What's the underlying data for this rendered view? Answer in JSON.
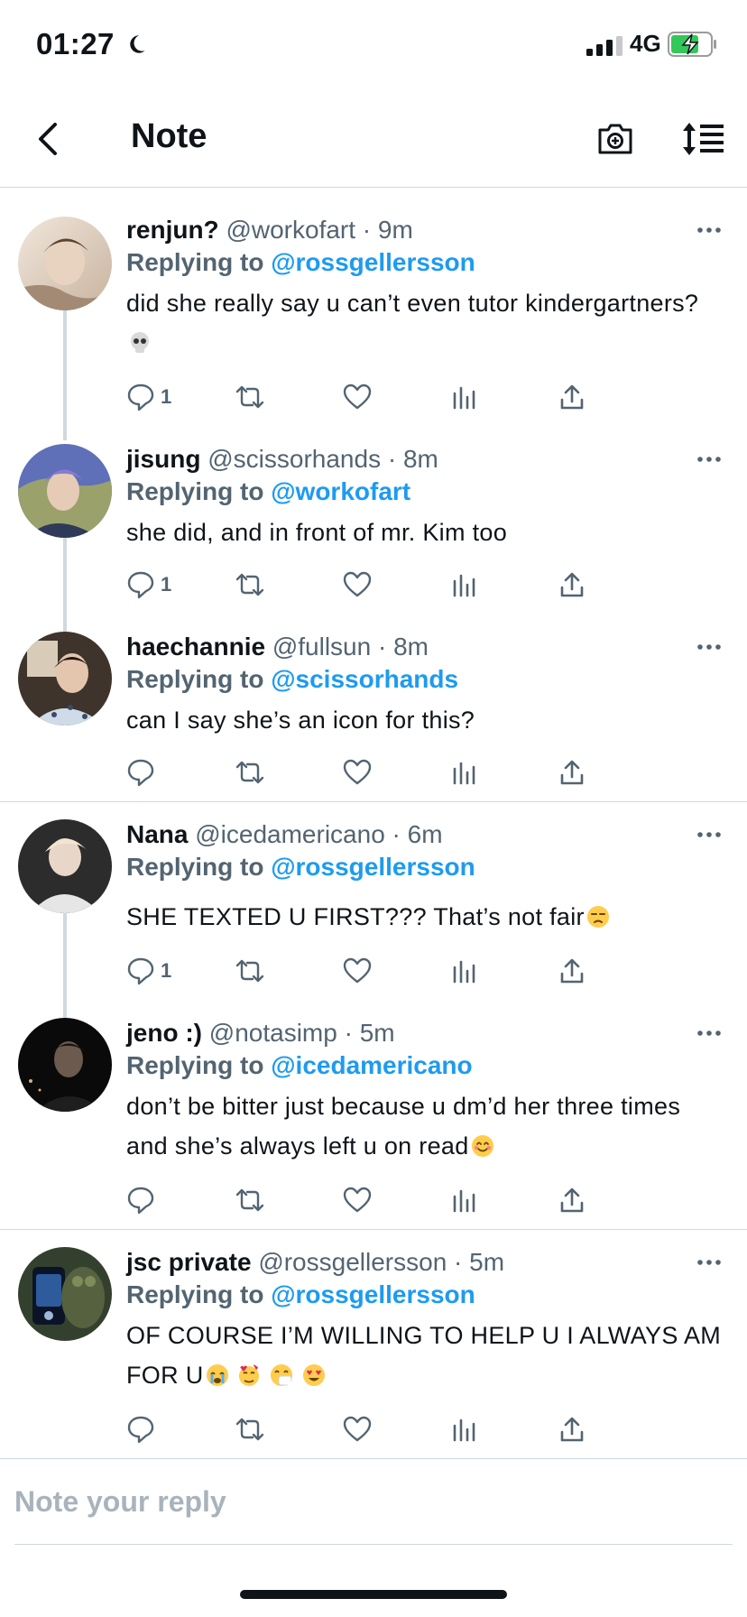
{
  "status_bar": {
    "time": "01:27",
    "network": "4G"
  },
  "header": {
    "title": "Note",
    "back_icon": "chevron-left-icon",
    "camera_icon": "camera-plus-icon",
    "sort_icon": "sort-list-icon"
  },
  "tweets": [
    {
      "name": "renjun?",
      "handle": "@workofart · 9m",
      "reply_prefix": "Replying to",
      "reply_to": "@rossgellersson",
      "text": "did she really say u can’t even tutor kindergartners?",
      "emoji": "skull",
      "reply_count": "1",
      "colors": [
        "#d9c9b8",
        "#f1e7dc"
      ]
    },
    {
      "name": "jisung",
      "handle": "@scissorhands · 8m",
      "reply_prefix": "Replying to",
      "reply_to": "@workofart",
      "text": "she did, and in front of mr. Kim too",
      "reply_count": "1",
      "colors": [
        "#4a56a8",
        "#8a93c4"
      ]
    },
    {
      "name": "haechannie",
      "handle": "@fullsun · 8m",
      "reply_prefix": "Replying to",
      "reply_to": "@scissorhands",
      "text": "can I say she’s an icon for this?",
      "reply_count": "",
      "colors": [
        "#3d332a",
        "#b9a995"
      ]
    },
    {
      "name": "Nana",
      "handle": "@icedamericano · 6m",
      "reply_prefix": "Replying to",
      "reply_to": "@rossgellersson",
      "text": "SHE TEXTED U FIRST??? That’s not fair",
      "emoji": "unamused",
      "reply_count": "1",
      "colors": [
        "#2b2b2b",
        "#d7d7d7"
      ]
    },
    {
      "name": "jeno :)",
      "handle": "@notasimp · 5m",
      "reply_prefix": "Replying to",
      "reply_to": "@icedamericano",
      "text": "don’t be bitter just because u dm’d her three times and she’s always left u on read",
      "emoji": "blush",
      "reply_count": "",
      "colors": [
        "#0b0b0b",
        "#4a4a4a"
      ]
    },
    {
      "name": "jsc private",
      "handle": "@rossgellersson · 5m",
      "reply_prefix": "Replying to",
      "reply_to": "@rossgellersson",
      "text": "OF COURSE I’M WILLING TO HELP U I ALWAYS AM FOR U",
      "emoji": "crying, smiling-hearts, sneezing, heart-eyes",
      "reply_count": "",
      "colors": [
        "#2a3a2a",
        "#4c5d3c"
      ]
    }
  ],
  "composer": {
    "placeholder": "Note your reply"
  },
  "colors": {
    "accent": "#1d9bf0",
    "secondary_text": "#536471",
    "divider": "#cfd9de"
  }
}
